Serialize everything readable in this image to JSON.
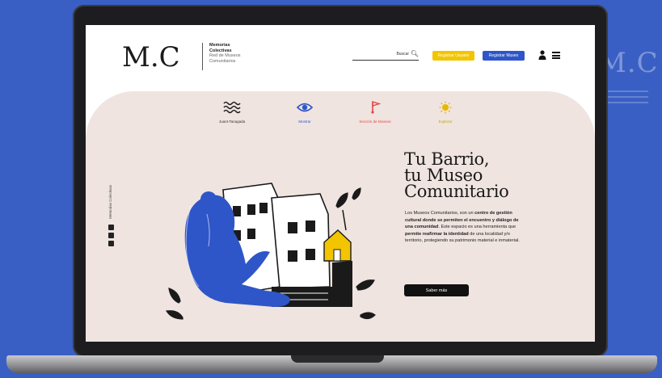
{
  "background_logo": "M.C",
  "site": {
    "logo_mark": "M.C",
    "logo_lines": [
      "Memorias",
      "Colectivas",
      "Red de Museos",
      "Comunitarios"
    ]
  },
  "header": {
    "search_label": "Buscar",
    "register_user_label": "Registrar Usuario",
    "register_museum_label": "Registrar Museo"
  },
  "nav": [
    {
      "label": "Juant-Tanagada",
      "color": "#333333",
      "icon": "waves-icon"
    },
    {
      "label": "Mostrar",
      "color": "#2e56c8",
      "icon": "eye-icon"
    },
    {
      "label": "Sección de Museos",
      "color": "#e04848",
      "icon": "flag-icon"
    },
    {
      "label": "Explorar",
      "color": "#e6b800",
      "icon": "sun-icon"
    }
  ],
  "side_text": "Memorias Colectivas",
  "hero": {
    "title_lines": [
      "Tu Barrio,",
      "tu Museo",
      "Comunitario"
    ],
    "desc_plain_1": "Los Museos Comunitarios, son un ",
    "desc_bold_1": "centro de gestión cultural donde se permiten el encuentro y diálogo de una comunidad",
    "desc_plain_2": ". Este espacio es una herramienta que ",
    "desc_bold_2": "permite reafirmar la identidad",
    "desc_plain_3": " de una localidad y/o territorio, protegiendo su patrimonio material e inmaterial.",
    "cta_label": "Saber más"
  },
  "colors": {
    "page_bg": "#3a5fc4",
    "hero_bg": "#efe4e0",
    "accent_yellow": "#f2c500",
    "accent_blue": "#2e56c8",
    "accent_red": "#e04848"
  }
}
